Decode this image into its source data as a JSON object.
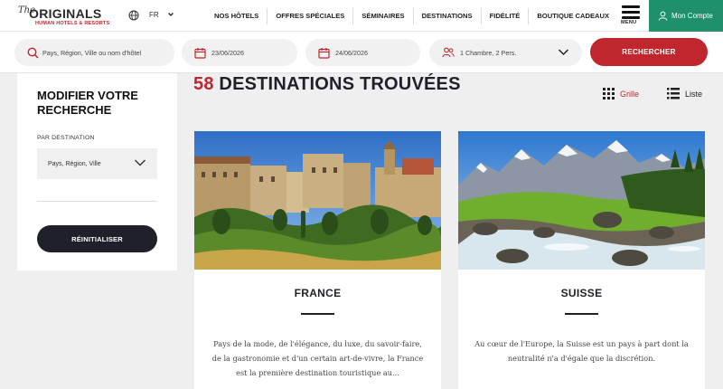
{
  "brand": {
    "the": "The",
    "name": "ORIGINALS",
    "tagline": "HUMAN HOTELS & RESORTS"
  },
  "header": {
    "language": "FR",
    "nav": [
      "NOS HÔTELS",
      "OFFRES SPÉCIALES",
      "SÉMINAIRES",
      "DESTINATIONS",
      "FIDÉLITÉ",
      "BOUTIQUE CADEAUX"
    ],
    "menu_label": "MENU",
    "account_label": "Mon Compte",
    "accent_color": "#1f8f6c"
  },
  "search": {
    "destination_placeholder": "Pays, Région, Ville ou nom d'hôtel",
    "checkin": "23/06/2026",
    "checkout": "24/06/2026",
    "guests": "1 Chambre, 2 Pers.",
    "submit_label": "RECHERCHER",
    "submit_color": "#c0262d"
  },
  "sidebar": {
    "title": "MODIFIER VOTRE RECHERCHE",
    "filter_label": "PAR DESTINATION",
    "filter_value": "Pays, Région, Ville",
    "reset_label": "RÉINITIALISER"
  },
  "results": {
    "count": "58",
    "title_rest": "DESTINATIONS TROUVÉES",
    "view_grid": "Grille",
    "view_list": "Liste"
  },
  "cards": [
    {
      "title": "FRANCE",
      "image": "village-landscape-image",
      "description": "Pays de la mode, de l'élégance, du luxe, du savoir-faire, de la gastronomie et d'un certain art-de-vivre, la France est la première destination touristique au..."
    },
    {
      "title": "SUISSE",
      "image": "alpine-landscape-image",
      "description": "Au cœur de l'Europe, la Suisse est un pays à part dont la neutralité n'a d'égale que la discrétion."
    }
  ]
}
